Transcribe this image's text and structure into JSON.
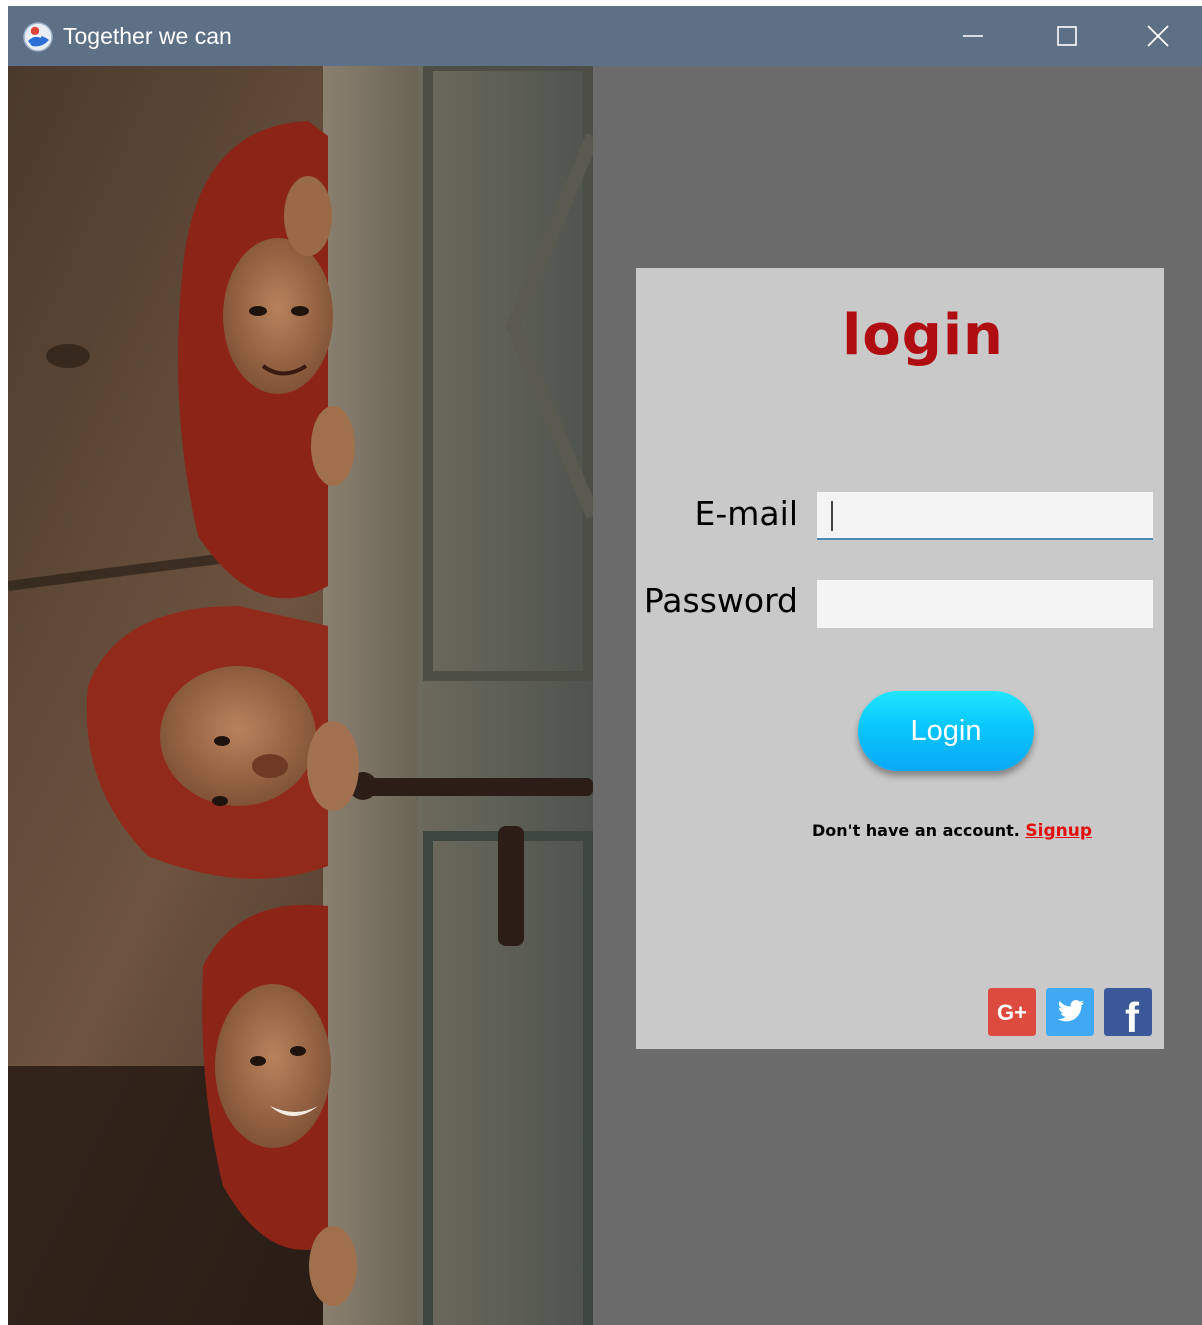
{
  "window": {
    "title": "Together we can",
    "minimize_label": "Minimize",
    "maximize_label": "Maximize",
    "close_label": "Close"
  },
  "login": {
    "title": "login",
    "email_label": "E-mail",
    "email_value": "",
    "password_label": "Password",
    "password_value": "",
    "button_label": "Login",
    "signup_prompt": "Don't have an account.",
    "signup_link": "Signup"
  },
  "social": {
    "google_label": "G+",
    "twitter_icon": "twitter-bird",
    "facebook_label": "f"
  },
  "colors": {
    "titlebar": "#5e7085",
    "window_bg": "#6b6b6b",
    "card_bg": "#c9c9c9",
    "title_red": "#b00d12",
    "link_red": "#e30d0d",
    "button_cyan": "#09c6fb",
    "google_red": "#dc4b3e",
    "twitter_blue": "#3fa9f5",
    "facebook_blue": "#3b5998"
  }
}
